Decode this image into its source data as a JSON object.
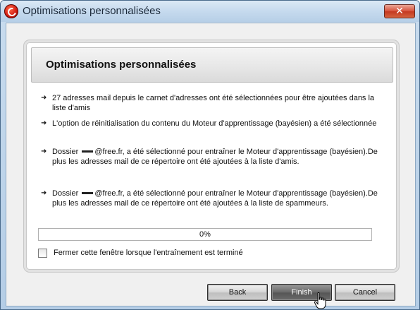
{
  "window": {
    "title": "Optimisations personnalisées",
    "close_label": "✕"
  },
  "panel": {
    "title": "Optimisations personnalisées",
    "items": [
      {
        "text": "27 adresses mail depuis le carnet d'adresses ont été sélectionnées pour être ajoutées dans la liste d'amis"
      },
      {
        "text": "L'option de réinitialisation du contenu du Moteur d'apprentissage (bayésien) a été sélectionnée"
      },
      {
        "prefix": "Dossier",
        "suffix": "@free.fr, a été sélectionné pour entraîner le Moteur d'apprentissage (bayésien).De plus les adresses mail de ce répertoire ont été ajoutées à la liste d'amis."
      },
      {
        "prefix": "Dossier",
        "suffix": "@free.fr, a été sélectionné pour entraîner le Moteur d'apprentissage (bayésien).De plus les adresses mail de ce répertoire ont été ajoutées à la liste de spammeurs."
      }
    ],
    "progress_label": "0%",
    "progress_value": 0,
    "checkbox_label": "Fermer cette fenêtre lorsque l'entraînement est terminé",
    "checkbox_checked": false
  },
  "buttons": {
    "back": "Back",
    "finish": "Finish",
    "cancel": "Cancel"
  },
  "colors": {
    "titlebar": "#c6daee",
    "close_button": "#c43820",
    "app_icon": "#d01a10"
  },
  "icons": [
    "app-logo-icon",
    "close-icon",
    "arrow-right-icon",
    "hand-pointer-cursor"
  ]
}
